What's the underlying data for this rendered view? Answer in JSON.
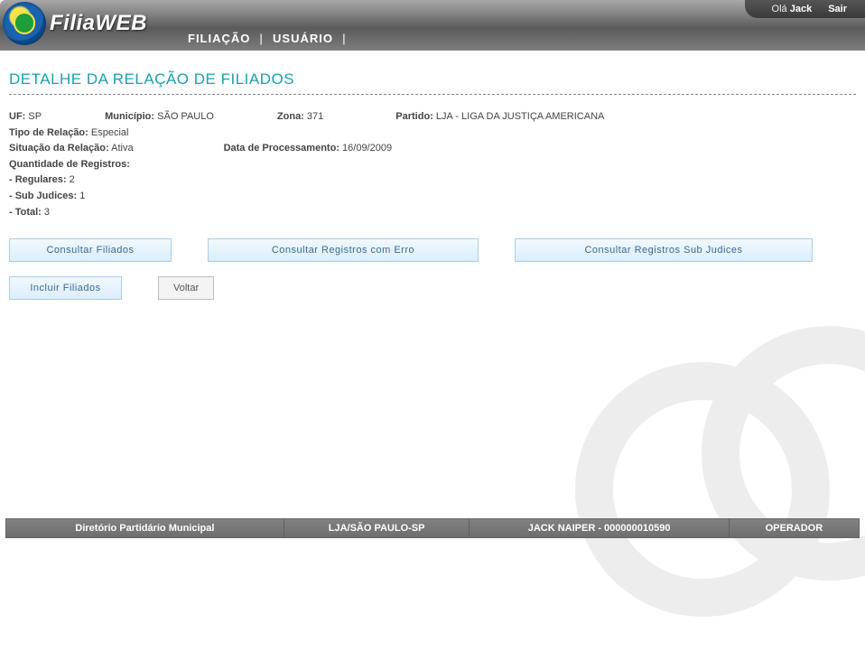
{
  "header": {
    "brand": "FiliaWEB",
    "nav": {
      "item1": "FILIAÇÃO",
      "item2": "USUÁRIO"
    },
    "greeting_prefix": "Olá ",
    "username": "Jack",
    "logout": "Sair"
  },
  "page_title": "DETALHE DA RELAÇÃO DE FILIADOS",
  "details": {
    "uf_label": "UF:",
    "uf_value": "SP",
    "municipio_label": "Município:",
    "municipio_value": "SÃO PAULO",
    "zona_label": "Zona:",
    "zona_value": "371",
    "partido_label": "Partido:",
    "partido_value": "LJA - LIGA DA JUSTIÇA AMERICANA",
    "tipo_relacao_label": "Tipo de Relação:",
    "tipo_relacao_value": "Especial",
    "situacao_label": "Situação da Relação:",
    "situacao_value": "Ativa",
    "data_proc_label": "Data de Processamento:",
    "data_proc_value": "16/09/2009",
    "qtd_label": "Quantidade de Registros:",
    "regulares_label": "- Regulares:",
    "regulares_value": "2",
    "subjudices_label": "- Sub Judices:",
    "subjudices_value": "1",
    "total_label": "- Total:",
    "total_value": "3"
  },
  "buttons": {
    "consultar_filiados": "Consultar Filiados",
    "consultar_erro": "Consultar Registros com Erro",
    "consultar_subjudices": "Consultar Registros Sub Judices",
    "incluir_filiados": "Incluir Filiados",
    "voltar": "Voltar"
  },
  "footer": {
    "cell1": "Diretório Partidário Municipal",
    "cell2": "LJA/SÃO PAULO-SP",
    "cell3": "JACK NAIPER - 000000010590",
    "cell4": "OPERADOR"
  }
}
